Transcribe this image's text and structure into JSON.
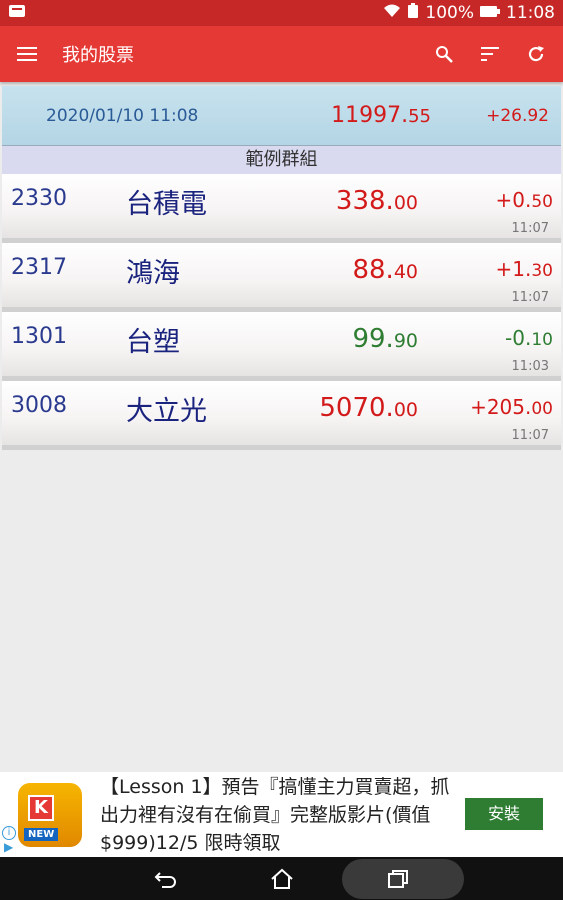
{
  "status": {
    "battery": "100%",
    "time": "11:08"
  },
  "appbar": {
    "title": "我的股票"
  },
  "index": {
    "datetime": "2020/01/10 11:08",
    "value_int": "11997.",
    "value_dec": "55",
    "change": "+26.92"
  },
  "group": {
    "name": "範例群組"
  },
  "stocks": [
    {
      "code": "2330",
      "name": "台積電",
      "price_int": "338.",
      "price_dec": "00",
      "change_int": "+0.",
      "change_dec": "50",
      "time": "11:07",
      "trend": "up"
    },
    {
      "code": "2317",
      "name": "鴻海",
      "price_int": "88.",
      "price_dec": "40",
      "change_int": "+1.",
      "change_dec": "30",
      "time": "11:07",
      "trend": "up"
    },
    {
      "code": "1301",
      "name": "台塑",
      "price_int": "99.",
      "price_dec": "90",
      "change_int": "-0.",
      "change_dec": "10",
      "time": "11:03",
      "trend": "down"
    },
    {
      "code": "3008",
      "name": "大立光",
      "price_int": "5070.",
      "price_dec": "00",
      "change_int": "+205.",
      "change_dec": "00",
      "time": "11:07",
      "trend": "up"
    }
  ],
  "ad": {
    "logo_letter": "K",
    "logo_badge": "NEW",
    "text": "【Lesson 1】預告『搞懂主力買賣超，抓出力裡有沒有在偷買』完整版影片(價值$999)12/5 限時領取",
    "install": "安裝"
  },
  "colors": {
    "up": "#d31a1a",
    "down": "#2e7d32",
    "appbar": "#e53935"
  }
}
